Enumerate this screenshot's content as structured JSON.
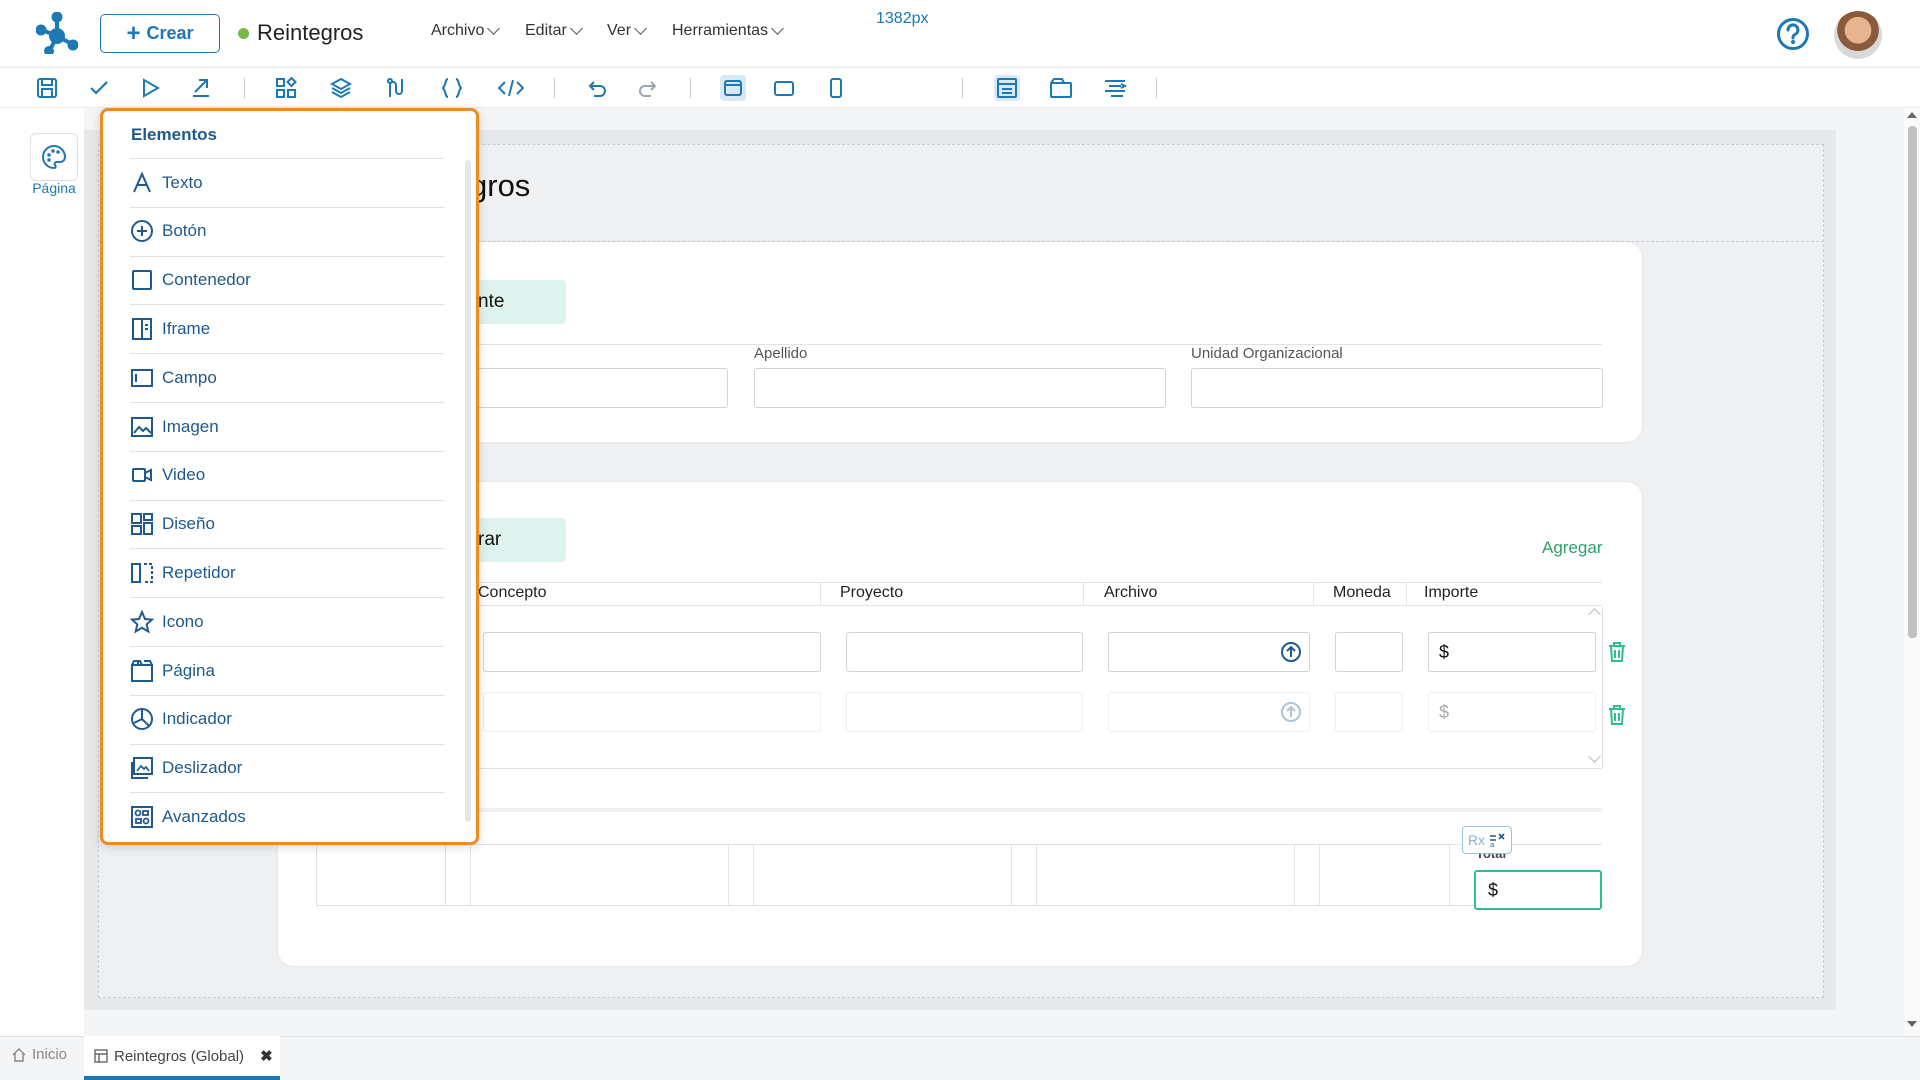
{
  "header": {
    "create_label": "Crear",
    "app_title": "Reintegros",
    "menus": [
      "Archivo",
      "Editar",
      "Ver",
      "Herramientas"
    ]
  },
  "toolbar": {
    "width_value": "1382px"
  },
  "left_rail": {
    "page_label": "Página"
  },
  "canvas": {
    "heading_fragment": "gros",
    "section1_chip_fragment": "nte",
    "section1_fields": [
      "Apellido",
      "Unidad Organizacional"
    ],
    "section2_chip_fragment": "rar",
    "add_label": "Agregar",
    "table_headers": [
      "Concepto",
      "Proyecto",
      "Archivo",
      "Moneda",
      "Importe"
    ],
    "currency_symbol": "$",
    "total_label": "Total",
    "rx_badge": "Rx"
  },
  "panel": {
    "title": "Elementos",
    "items": [
      {
        "label": "Texto",
        "icon": "text-icon"
      },
      {
        "label": "Botón",
        "icon": "plus-circle-icon"
      },
      {
        "label": "Contenedor",
        "icon": "square-icon"
      },
      {
        "label": "Iframe",
        "icon": "iframe-icon"
      },
      {
        "label": "Campo",
        "icon": "field-icon"
      },
      {
        "label": "Imagen",
        "icon": "image-icon"
      },
      {
        "label": "Video",
        "icon": "video-icon"
      },
      {
        "label": "Diseño",
        "icon": "layout-icon"
      },
      {
        "label": "Repetidor",
        "icon": "repeater-icon"
      },
      {
        "label": "Icono",
        "icon": "star-icon"
      },
      {
        "label": "Página",
        "icon": "page-icon"
      },
      {
        "label": "Indicador",
        "icon": "indicator-icon"
      },
      {
        "label": "Deslizador",
        "icon": "slider-icon"
      },
      {
        "label": "Avanzados",
        "icon": "advanced-icon"
      }
    ]
  },
  "bottom_tabs": {
    "home_label": "Inicio",
    "open_tab_label": "Reintegros (Global)"
  },
  "colors": {
    "accent": "#1e78b4",
    "panel_border": "#f08c1e",
    "success": "#2aa36b",
    "status_dot": "#7ab648"
  }
}
